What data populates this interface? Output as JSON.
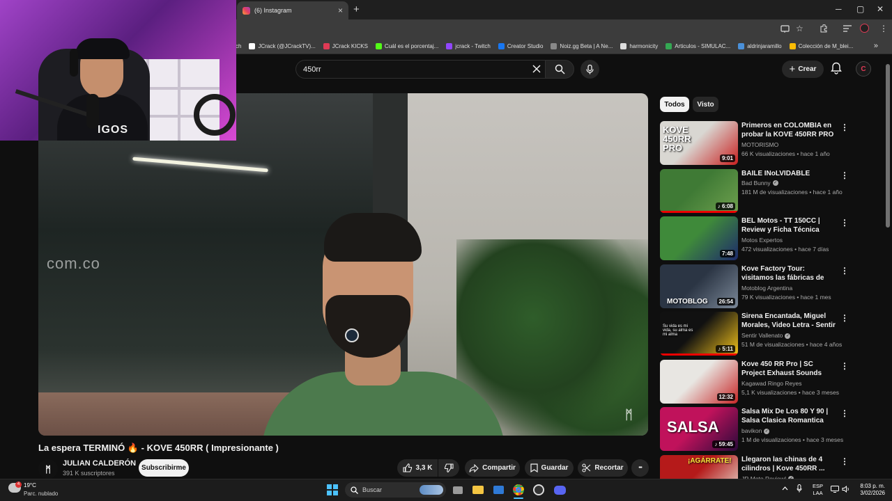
{
  "browser": {
    "tab_title": "(6) Instagram",
    "close_glyph": "×",
    "new_tab_glyph": "+",
    "window": {
      "minimize": "─",
      "maximize": "▢",
      "close": "✕"
    },
    "bookmarks": [
      {
        "label": "ch",
        "color": ""
      },
      {
        "label": "JCrack (@JCrackTV)...",
        "color": "#ffffff"
      },
      {
        "label": "JCrack KICKS",
        "color": "#e03a55"
      },
      {
        "label": "Cuál es el porcentaj...",
        "color": "#53fc18"
      },
      {
        "label": "jcrack - Twitch",
        "color": "#9146ff"
      },
      {
        "label": "Creator Studio",
        "color": "#1877f2"
      },
      {
        "label": "Noiz.gg Beta | A Ne...",
        "color": "#888888"
      },
      {
        "label": "harmonicity",
        "color": "#dddddd"
      },
      {
        "label": "Articulos - SIMULAC...",
        "color": "#34a853"
      },
      {
        "label": "aldrinjaramillo",
        "color": "#4a90d9"
      },
      {
        "label": "Colección de M_blei...",
        "color": "#fbbc05"
      }
    ],
    "bookmarks_more": "»"
  },
  "youtube": {
    "search_value": "450rr",
    "create_label": "Crear",
    "avatar_letter": "C"
  },
  "video": {
    "overlay_text": "com.co",
    "title": "La espera TERMINÓ 🔥 - KOVE 450RR ( Impresionante )",
    "channel": "JULIAN CALDERÓN",
    "subscribers": "391 K suscriptores",
    "subscribe_label": "Subscribirme",
    "likes": "3,3 K",
    "share_label": "Compartir",
    "save_label": "Guardar",
    "clip_label": "Recortar",
    "more_glyph": "•••"
  },
  "webcam": {
    "shirt_text": "IGOS"
  },
  "sidebar": {
    "chips": [
      {
        "label": "Todos",
        "active": true
      },
      {
        "label": "Visto",
        "active": false
      }
    ],
    "recommendations": [
      {
        "title": "Primeros en COLOMBIA en probar la KOVE 450RR PRO la ...",
        "channel": "MOTORISMO",
        "verified": false,
        "meta": "66 K visualizaciones • hace 1 año",
        "duration": "9:01",
        "thumb_text": "KOVE 450RR PRO",
        "colors": [
          "#d9d7d2",
          "#c92020"
        ],
        "watched": false
      },
      {
        "title": "BAILE INoLVIDABLE",
        "channel": "Bad Bunny",
        "verified": true,
        "meta": "181 M de visualizaciones • hace 1 año",
        "duration": "♪ 6:08",
        "thumb_text": "",
        "colors": [
          "#3f7a35",
          "#6ea04e"
        ],
        "watched": true
      },
      {
        "title": "BEL Motos -  TT 150CC | Review y Ficha Técnica Completa",
        "channel": "Motos Expertos",
        "verified": false,
        "meta": "472 visualizaciones • hace 7 días",
        "duration": "7:48",
        "thumb_text": "",
        "colors": [
          "#3f8a3a",
          "#1d2a6b"
        ],
        "watched": false
      },
      {
        "title": "Kove Factory Tour: visitamos las fábricas de una de las ...",
        "channel": "Motoblog Argentina",
        "verified": false,
        "meta": "79 K visualizaciones • hace 1 mes",
        "duration": "26:54",
        "thumb_text": "MOTOBLOG",
        "colors": [
          "#2b3544",
          "#7a8797"
        ],
        "watched": false
      },
      {
        "title": "Sirena Encantada, Miguel Morales, Video Letra - Sentir ...",
        "channel": "Sentir Vallenato",
        "verified": true,
        "meta": "51 M de visualizaciones • hace 4 años",
        "duration": "♪ 5:11",
        "thumb_text": "Su vida es mi vida, su alma es mi alma",
        "colors": [
          "#111111",
          "#f2c21b"
        ],
        "watched": true
      },
      {
        "title": "Kove 450 RR Pro | SC Project Exhaust Sounds",
        "channel": "Kagawad Ringo Reyes",
        "verified": false,
        "meta": "5,1 K visualizaciones • hace 3 meses",
        "duration": "12:32",
        "thumb_text": "",
        "colors": [
          "#e8e6e2",
          "#c72727"
        ],
        "watched": false
      },
      {
        "title": "Salsa Mix De Los 80 Y 90 | Salsa Clasica Romantica Vieja...",
        "channel": "bavikon",
        "verified": true,
        "meta": "1 M de visualizaciones • hace 3 meses",
        "duration": "♪ 59:45",
        "thumb_text": "SALSA",
        "colors": [
          "#c0125b",
          "#2a0a3b"
        ],
        "watched": false
      },
      {
        "title": "Llegaron las chinas de 4 cilindros | Kove 450RR ...",
        "channel": "JR Moto Review!",
        "verified": true,
        "meta": "",
        "duration": "",
        "thumb_text": "¡AGÁRRATE!",
        "colors": [
          "#b51a1a",
          "#e9e4d8"
        ],
        "watched": false
      }
    ]
  },
  "taskbar": {
    "weather_badge": "4",
    "temperature": "19°C",
    "weather": "Parc. nublado",
    "search_placeholder": "Buscar",
    "lang_line1": "ESP",
    "lang_line2": "LAA",
    "time": "8:03 p. m.",
    "date": "3/02/2026"
  }
}
